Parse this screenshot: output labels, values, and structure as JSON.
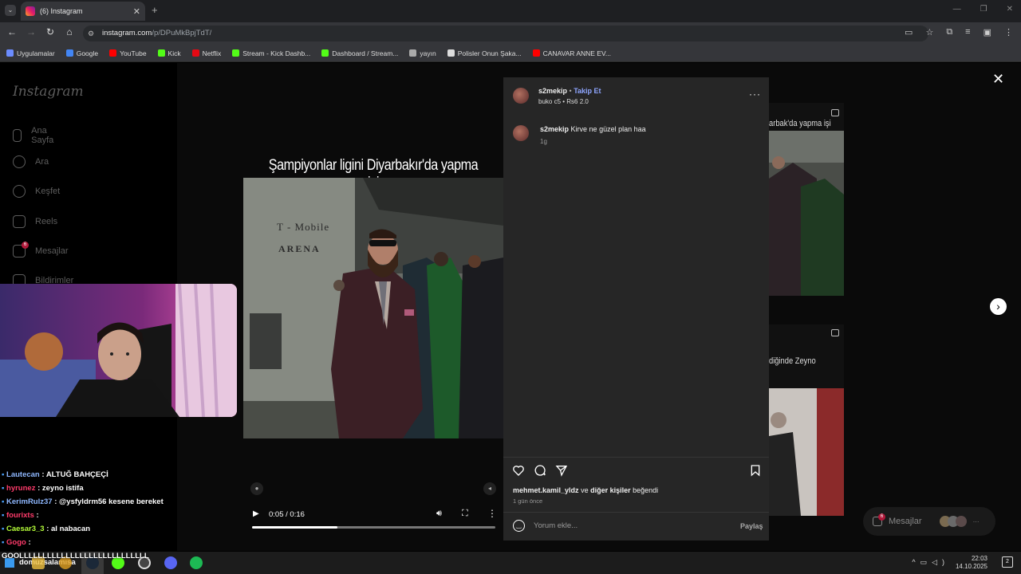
{
  "browser": {
    "tab_title": "(6) Instagram",
    "url_host": "instagram.com",
    "url_path": "/p/DPuMkBpjTdT/",
    "bookmarks": [
      "Uygulamalar",
      "Google",
      "YouTube",
      "Kick",
      "Netflix",
      "Stream - Kick Dashb...",
      "Dashboard / Stream...",
      "yayın",
      "Polisler Onun Şaka...",
      "CANAVAR ANNE EV..."
    ],
    "bookmark_colors": [
      "#6b8cff",
      "#4285f4",
      "#ff0000",
      "#53fc18",
      "#e50914",
      "#53fc18",
      "#53fc18",
      "#aaaaaa",
      "#dddddd",
      "#ff0000"
    ]
  },
  "sidebar": {
    "logo": "Instagram",
    "items": [
      "Ana Sayfa",
      "Ara",
      "Keşfet",
      "Reels",
      "Mesajlar",
      "Bildirimler"
    ],
    "messages_badge": "6"
  },
  "post": {
    "caption_overlay": "Şampiyonlar ligini Diyarbakır'da yapma işi",
    "arena_text_1": "T - Mobile",
    "arena_text_2": "ARENA",
    "video_time": "0:05 / 0:16",
    "progress": 0.35,
    "author": "s2mekip",
    "follow_label": "Takip Et",
    "audio": "buko c5 • Rs6 2.0",
    "comment_user": "s2mekip",
    "comment_text": "Kirve ne güzel plan haa",
    "comment_age": "1g",
    "likes_user": "mehmet.kamil_yldz",
    "likes_connector": "ve",
    "likes_others": "diğer kişiler",
    "likes_suffix": "beğendi",
    "post_age": "1 gün önce",
    "comment_placeholder": "Yorum ekle...",
    "share_label": "Paylaş"
  },
  "right": {
    "thumb_text_1": "arbak'da yapma işi",
    "thumb_text_2": "diğinde Zeyno",
    "messages_label": "Mesajlar",
    "messages_badge": "6"
  },
  "chat": [
    {
      "user": "Lautecan",
      "msg": ": ALTUĞ BAHÇEÇİ",
      "color": "#8fb8ff"
    },
    {
      "user": "hyrunez",
      "msg": ": zeyno istifa",
      "color": "#ff3b6b"
    },
    {
      "user": "KerimRulz37",
      "msg": ": @ysfyldrm56 kesene bereket",
      "color": "#8fb8ff"
    },
    {
      "user": "fourixts",
      "msg": ":",
      "color": "#ff3b6b"
    },
    {
      "user": "Caesar3_3",
      "msg": ": al nabacan",
      "color": "#b6ff3a"
    },
    {
      "user": "Gogo",
      "msg": ":",
      "color": "#ff3b6b"
    },
    {
      "user": "",
      "msg": "GOOLLLLLLLLLLLLLLLLLLLLLLLLLLLL",
      "color": "#ffffff"
    }
  ],
  "taskbar": {
    "search_text": "domuzsalamısa",
    "time": "22:03",
    "date": "14.10.2025",
    "notif_count": "2"
  }
}
